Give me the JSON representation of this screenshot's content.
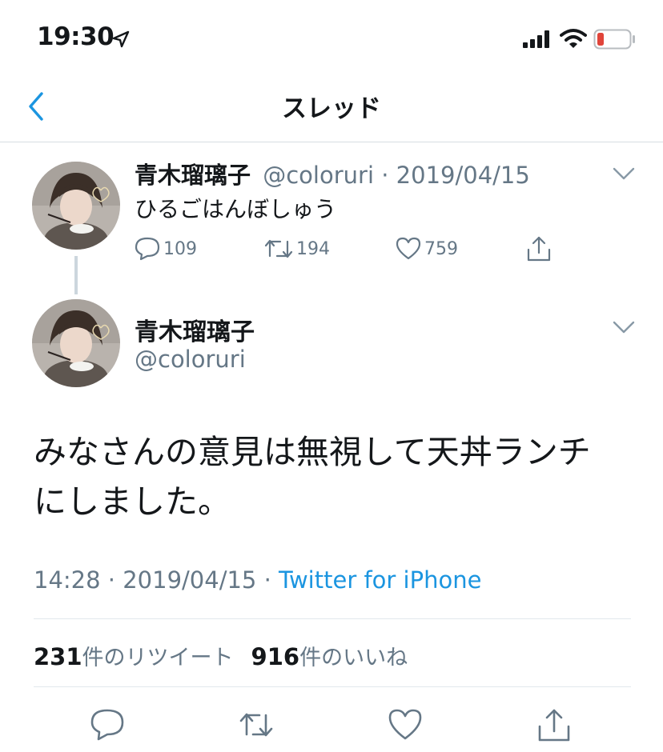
{
  "status_bar": {
    "time": "19:30",
    "colors": {
      "battery_low": "#e0443a"
    }
  },
  "nav": {
    "title": "スレッド",
    "back_icon": "chevron-left-icon",
    "accent": "#1b95e0"
  },
  "thread": {
    "tweet1": {
      "name": "青木瑠璃子",
      "handle": "@coloruri",
      "separator": " · ",
      "date": "2019/04/15",
      "text": "ひるごはんぼしゅう",
      "reply_count": "109",
      "retweet_count": "194",
      "like_count": "759",
      "icons": [
        "reply-icon",
        "retweet-icon",
        "like-icon",
        "share-icon",
        "chevron-down-icon"
      ]
    },
    "tweet2": {
      "name": "青木瑠璃子",
      "handle": "@coloruri",
      "text_line1": "みなさんの意見は無視して天丼ランチ",
      "text_line2": "にしました。",
      "time": "14:28",
      "separator1": " · ",
      "date": "2019/04/15",
      "separator2": " · ",
      "source": "Twitter for iPhone",
      "retweets_num": "231",
      "retweets_label": "件のリツイート",
      "likes_num": "916",
      "likes_label": "件のいいね",
      "icons": [
        "reply-icon",
        "retweet-icon",
        "like-icon",
        "share-icon",
        "chevron-down-icon"
      ]
    }
  }
}
